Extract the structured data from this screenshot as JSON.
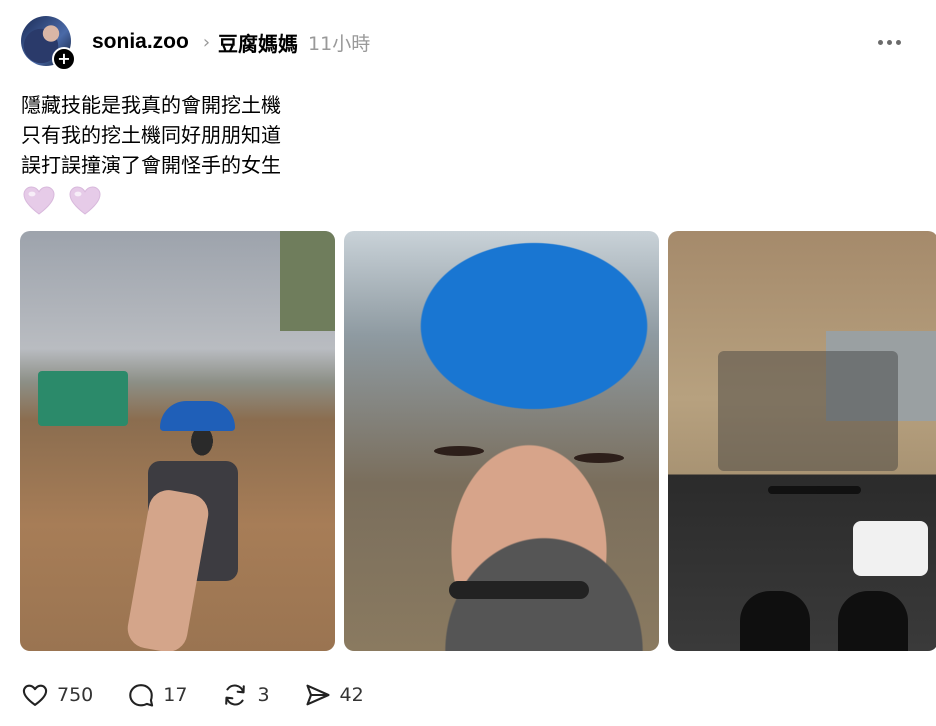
{
  "header": {
    "username": "sonia.zoo",
    "tag": "豆腐媽媽",
    "time": "11小時"
  },
  "post": {
    "lines": [
      "隱藏技能是我真的會開挖土機",
      "只有我的挖土機同好朋朋知道",
      "誤打誤撞演了會開怪手的女生"
    ],
    "emoji": [
      "heart-icon",
      "heart-icon"
    ],
    "heart_color": "#e3c9e6"
  },
  "images": [
    {
      "name": "excavator-site-selfie"
    },
    {
      "name": "blue-helmet-closeup"
    },
    {
      "name": "excavator-cab-view"
    }
  ],
  "actions": {
    "likes": "750",
    "comments": "17",
    "reposts": "3",
    "shares": "42"
  },
  "icons": {
    "add": "plus-icon",
    "chevron": "chevron-right-icon",
    "more": "more-dots-icon"
  }
}
